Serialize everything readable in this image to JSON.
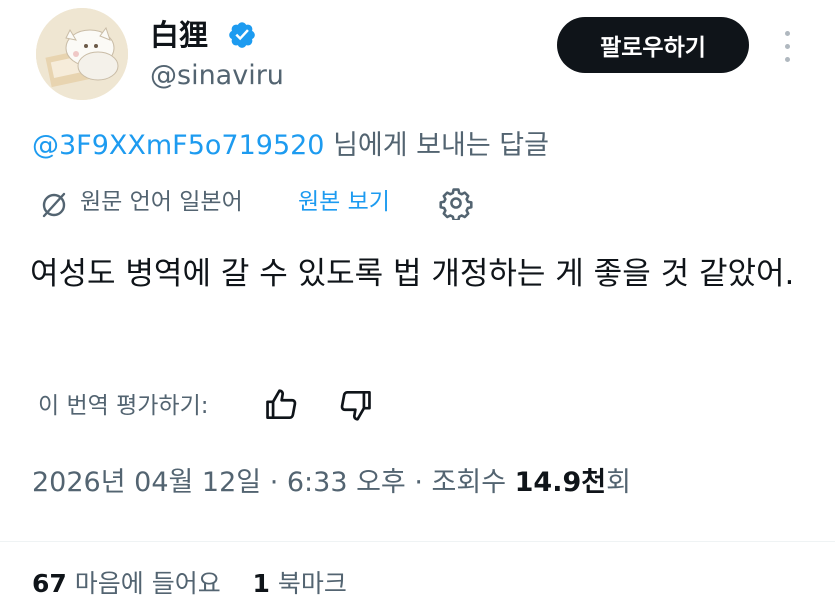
{
  "author": {
    "display_name": "白狸",
    "handle": "@sinaviru",
    "verified": true
  },
  "follow_button": {
    "label": "팔로우하기"
  },
  "reply_to": {
    "mention": "@3F9XXmF5o719520",
    "suffix": " 님에게 보내는 답글"
  },
  "translation": {
    "label": "원문 언어 일본어",
    "show_original": "원본 보기"
  },
  "tweet": {
    "text": "여성도 병역에 갈 수 있도록 법 개정하는 게 좋을 것 같았어."
  },
  "rate_translation": {
    "label": "이 번역 평가하기:"
  },
  "meta": {
    "date": "2026년 04월 12일",
    "time": "6:33 오후",
    "views_prefix": "조회수 ",
    "views_count": "14.9천",
    "views_suffix": "회",
    "separator": " · "
  },
  "stats": {
    "likes_count": "67",
    "likes_label": "마음에 들어요",
    "bookmarks_count": "1",
    "bookmarks_label": "북마크"
  },
  "colors": {
    "link": "#1d9bf0",
    "secondary_text": "#536471",
    "primary_text": "#0f1419",
    "follow_bg": "#0f1419"
  }
}
